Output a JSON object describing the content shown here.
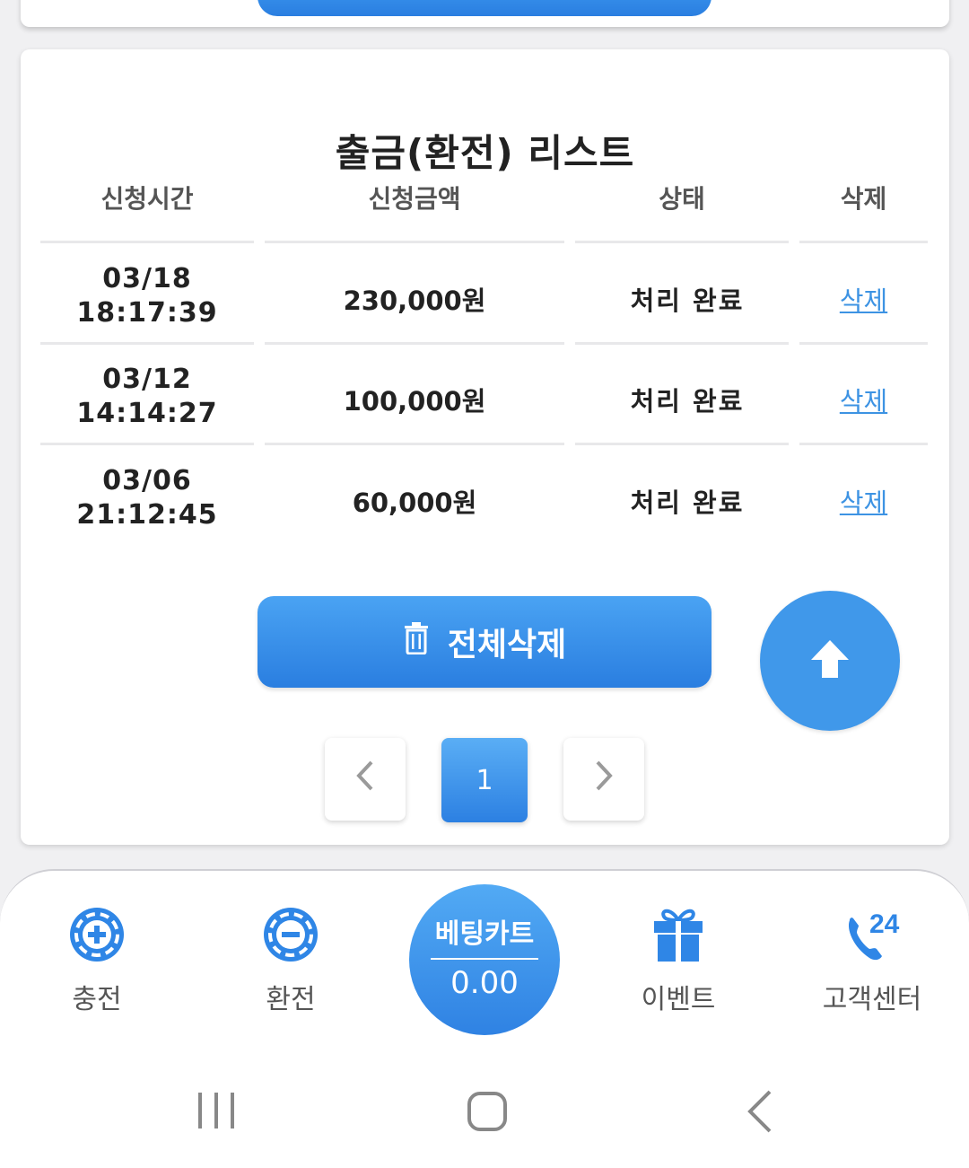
{
  "list": {
    "title": "출금(환전) 리스트",
    "headers": [
      "신청시간",
      "신청금액",
      "상태",
      "삭제"
    ],
    "rows": [
      {
        "date": "03/18",
        "time": "18:17:39",
        "amount": "230,000원",
        "status": "처리 완료",
        "delete": "삭제"
      },
      {
        "date": "03/12",
        "time": "14:14:27",
        "amount": "100,000원",
        "status": "처리 완료",
        "delete": "삭제"
      },
      {
        "date": "03/06",
        "time": "21:12:45",
        "amount": "60,000원",
        "status": "처리 완료",
        "delete": "삭제"
      }
    ],
    "delete_all_label": "전체삭제"
  },
  "pagination": {
    "current": "1",
    "prev_icon": "chevron-left-icon",
    "next_icon": "chevron-right-icon"
  },
  "bottom_nav": {
    "charge": "충전",
    "exchange": "환전",
    "bet_cart_label": "베팅카트",
    "bet_cart_value": "0.00",
    "event": "이벤트",
    "support": "고객센터",
    "support_badge": "24"
  },
  "colors": {
    "accent": "#2f86e6",
    "link": "#3d93e3"
  }
}
